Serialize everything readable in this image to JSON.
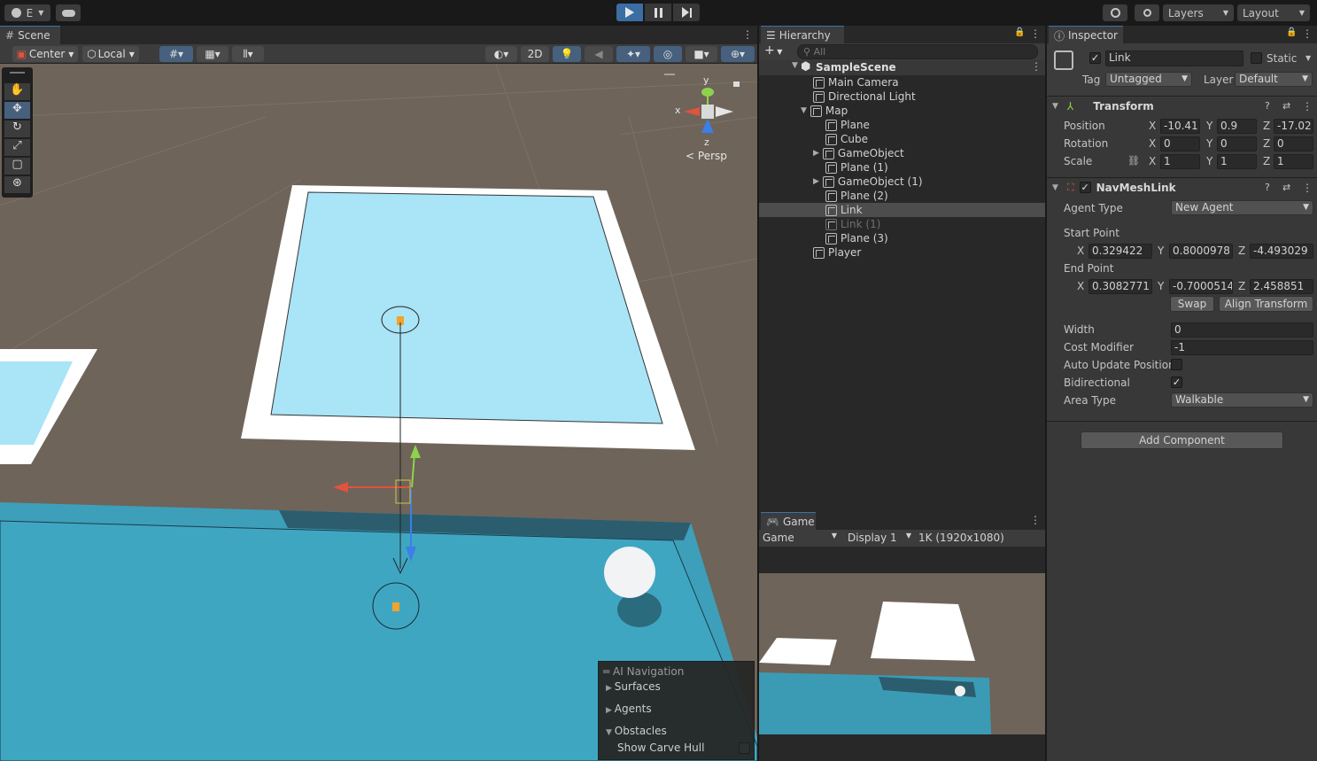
{
  "topbar": {
    "account_label": "E",
    "tools": {
      "layers": "Layers",
      "layout": "Layout"
    }
  },
  "scene": {
    "tab": "Scene",
    "pivot": "Center",
    "space": "Local",
    "mode_2d": "2D",
    "gizmo": {
      "y": "y",
      "x": "x",
      "z": "z",
      "persp": "Persp"
    }
  },
  "ai_nav": {
    "title": "AI Navigation",
    "items": [
      "Surfaces",
      "Agents",
      "Obstacles"
    ],
    "show_carve": "Show Carve Hull"
  },
  "hierarchy": {
    "tab": "Hierarchy",
    "search_placeholder": "All",
    "scene": "SampleScene",
    "items": [
      "Main Camera",
      "Directional Light",
      "Map",
      "Plane",
      "Cube",
      "GameObject",
      "Plane (1)",
      "GameObject (1)",
      "Plane (2)",
      "Link",
      "Link (1)",
      "Plane (3)",
      "Player"
    ]
  },
  "game": {
    "tab": "Game",
    "view": "Game",
    "display": "Display 1",
    "resolution": "1K (1920x1080)"
  },
  "inspector": {
    "tab": "Inspector",
    "name": "Link",
    "static": "Static",
    "tag_label": "Tag",
    "tag": "Untagged",
    "layer_label": "Layer",
    "layer": "Default",
    "transform": {
      "title": "Transform",
      "position_label": "Position",
      "rotation_label": "Rotation",
      "scale_label": "Scale",
      "position": [
        "-10.41",
        "0.9",
        "-17.02"
      ],
      "rotation": [
        "0",
        "0",
        "0"
      ],
      "scale": [
        "1",
        "1",
        "1"
      ]
    },
    "navlink": {
      "title": "NavMeshLink",
      "agent_type_label": "Agent Type",
      "agent_type": "New Agent",
      "start_label": "Start Point",
      "start": [
        "0.329422",
        "0.8000978",
        "-4.493029"
      ],
      "end_label": "End Point",
      "end": [
        "0.3082771",
        "-0.7000514",
        "2.458851"
      ],
      "swap": "Swap",
      "align": "Align Transform",
      "width_label": "Width",
      "width": "0",
      "cost_label": "Cost Modifier",
      "cost": "-1",
      "auto_label": "Auto Update Position",
      "bidir_label": "Bidirectional",
      "area_label": "Area Type",
      "area": "Walkable"
    },
    "add_component": "Add Component",
    "axes": {
      "x": "X",
      "y": "Y",
      "z": "Z"
    }
  }
}
